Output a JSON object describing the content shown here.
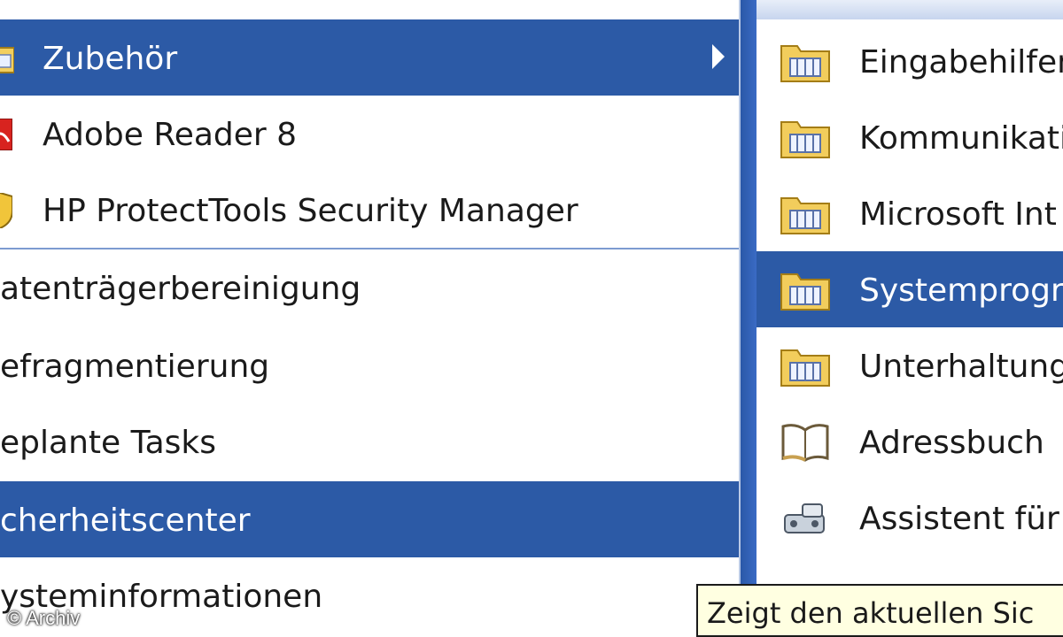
{
  "left_menu": {
    "items": [
      {
        "label": "Zubehör",
        "icon": "accessories-folder-icon",
        "selected": true,
        "has_submenu": true
      },
      {
        "label": "Adobe Reader 8",
        "icon": "adobe-reader-icon",
        "selected": false
      },
      {
        "label": "HP ProtectTools Security Manager",
        "icon": "security-shield-icon",
        "selected": false
      }
    ],
    "system_items": [
      {
        "label": "atenträgerbereinigung",
        "selected": false
      },
      {
        "label": "efragmentierung",
        "selected": false
      },
      {
        "label": "eplante Tasks",
        "selected": false
      },
      {
        "label": "cherheitscenter",
        "selected": true
      },
      {
        "label": "ysteminformationen",
        "selected": false
      }
    ]
  },
  "right_menu": {
    "items": [
      {
        "label": "Eingabehilfen",
        "icon": "folder-icon",
        "selected": false
      },
      {
        "label": "Kommunikatio",
        "icon": "folder-icon",
        "selected": false
      },
      {
        "label": "Microsoft Int",
        "icon": "folder-icon",
        "selected": false
      },
      {
        "label": "Systemprogr",
        "icon": "folder-icon",
        "selected": true
      },
      {
        "label": "Unterhaltung",
        "icon": "folder-icon",
        "selected": false
      },
      {
        "label": "Adressbuch",
        "icon": "address-book-icon",
        "selected": false
      },
      {
        "label": "Assistent für",
        "icon": "wizard-icon",
        "selected": false
      }
    ]
  },
  "tooltip": {
    "text": "Zeigt den aktuellen Sic"
  },
  "copyright": {
    "text": "© Archiv"
  },
  "colors": {
    "selection": "#2c5aa6",
    "separator": "#7d9bd1",
    "tooltip_bg": "#ffffe1"
  }
}
